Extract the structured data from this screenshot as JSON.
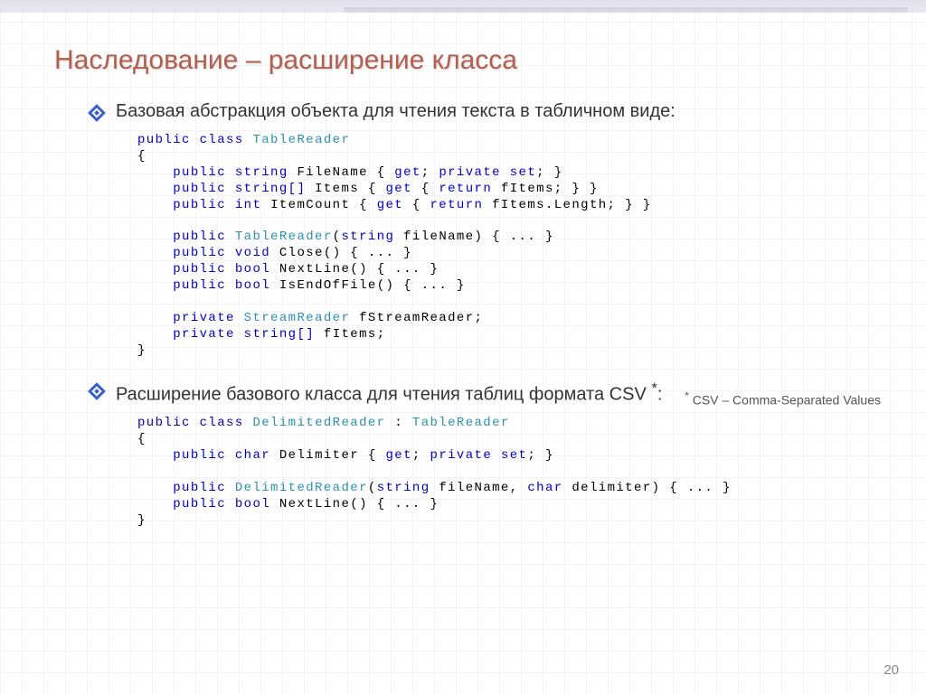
{
  "title": "Наследование – расширение класса",
  "bullet1": "Базовая абстракция объекта для чтения текста в табличном виде:",
  "bullet2_prefix": "Расширение базового класса для чтения таблиц формата CSV ",
  "bullet2_suffix": ":",
  "footnote_star": "*",
  "footnote_text": " CSV – Comma-Separated Values",
  "pagenum": "20",
  "kw": {
    "public": "public",
    "class": "class",
    "string": "string",
    "stringArr": "string[]",
    "int": "int",
    "get": "get",
    "private": "private",
    "set": "set",
    "return": "return",
    "void": "void",
    "bool": "bool",
    "char": "char"
  },
  "type": {
    "TableReader": "TableReader",
    "StreamReader": "StreamReader",
    "DelimitedReader": "DelimitedReader"
  },
  "id": {
    "FileName": "FileName",
    "Items": "Items",
    "ItemCount": "ItemCount",
    "fItems": "fItems",
    "fItemsLength": "fItems.Length",
    "fileName": "fileName",
    "Close": "Close",
    "NextLine": "NextLine",
    "IsEndOfFile": "IsEndOfFile",
    "fStreamReader": "fStreamReader",
    "Delimiter": "Delimiter",
    "delimiter": "delimiter"
  },
  "punct": {
    "obrace": "{",
    "cbrace": "}",
    "semib": "; }",
    "semi": ";",
    "ell": "{ ... }",
    "colon": " : "
  }
}
